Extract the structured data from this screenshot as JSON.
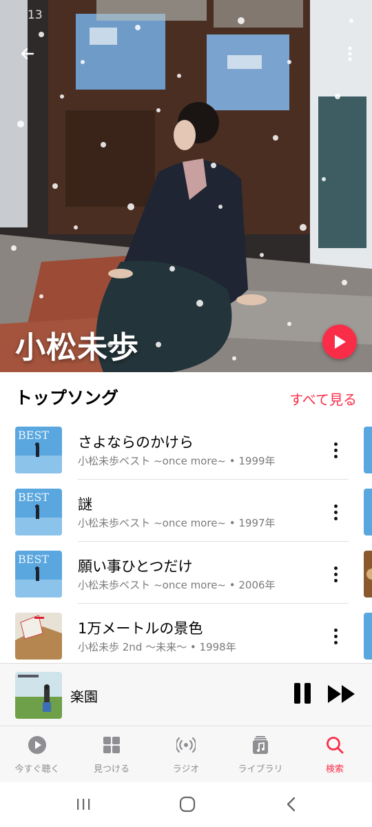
{
  "status": {
    "time": "13"
  },
  "artist": {
    "name": "小松未歩"
  },
  "top_songs": {
    "title": "トップソング",
    "see_all": "すべて見る",
    "songs": [
      {
        "title": "さよならのかけら",
        "subtitle": "小松未歩ベスト ~once more~ • 1999年",
        "art": "best-cover"
      },
      {
        "title": "謎",
        "subtitle": "小松未歩ベスト ~once more~ • 1997年",
        "art": "best-cover"
      },
      {
        "title": "願い事ひとつだけ",
        "subtitle": "小松未歩ベスト ~once more~ • 2006年",
        "art": "best-cover"
      },
      {
        "title": "1万メートルの景色",
        "subtitle": "小松未歩 2nd 〜未来〜 • 1998年",
        "art": "2nd-cover"
      }
    ]
  },
  "now_playing": {
    "title": "楽園"
  },
  "tabs": [
    {
      "label": "今すぐ聴く",
      "icon": "play-circle-icon",
      "active": false
    },
    {
      "label": "見つける",
      "icon": "grid-icon",
      "active": false
    },
    {
      "label": "ラジオ",
      "icon": "radio-icon",
      "active": false
    },
    {
      "label": "ライブラリ",
      "icon": "library-icon",
      "active": false
    },
    {
      "label": "検索",
      "icon": "search-icon",
      "active": true
    }
  ],
  "colors": {
    "accent": "#fa2d48",
    "secondary_text": "#7a7a7a",
    "tab_inactive": "#8e8e93"
  }
}
